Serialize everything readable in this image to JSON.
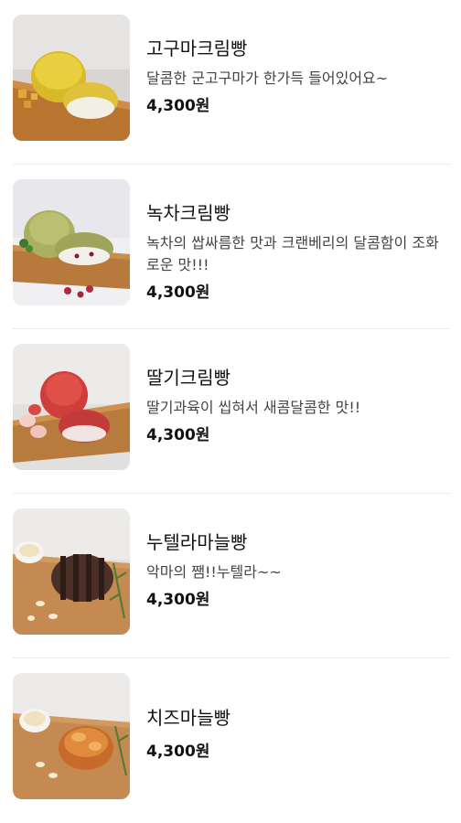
{
  "menu": [
    {
      "name": "고구마크림빵",
      "description": "달콤한 군고구마가 한가득 들어있어요~",
      "price": "4,300원"
    },
    {
      "name": "녹차크림빵",
      "description": "녹차의 쌉싸름한 맛과 크랜베리의 달콤함이 조화로운 맛!!!",
      "price": "4,300원"
    },
    {
      "name": "딸기크림빵",
      "description": "딸기과육이 씹혀서 새콤달콤한 맛!!",
      "price": "4,300원"
    },
    {
      "name": "누텔라마늘빵",
      "description": "악마의 쨈!!누텔라~~",
      "price": "4,300원"
    },
    {
      "name": "치즈마늘빵",
      "description": "",
      "price": "4,300원"
    }
  ]
}
